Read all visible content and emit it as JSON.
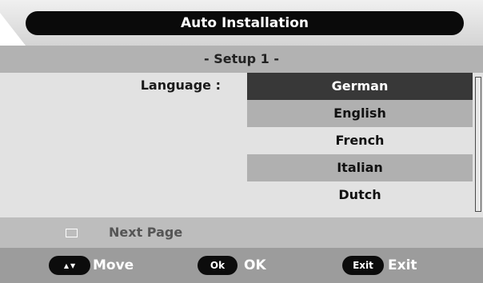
{
  "window": {
    "title": "Auto Installation"
  },
  "setup": {
    "title": "- Setup 1 -"
  },
  "language": {
    "label": "Language :",
    "options": [
      "German",
      "English",
      "French",
      "Italian",
      "Dutch"
    ],
    "selected": "German"
  },
  "next_page": {
    "label": "Next Page"
  },
  "footer": {
    "move": {
      "key_icon": "up-down-arrows-icon",
      "label": "Move"
    },
    "ok": {
      "key": "Ok",
      "label": "OK"
    },
    "exit": {
      "key": "Exit",
      "label": "Exit"
    }
  },
  "colors": {
    "title_bg": "#0a0a0a",
    "selected_bg": "#383838",
    "alt_row_bg": "#b0b0b0",
    "content_bg": "#e2e2e2",
    "footer_bg": "#9c9c9c"
  }
}
